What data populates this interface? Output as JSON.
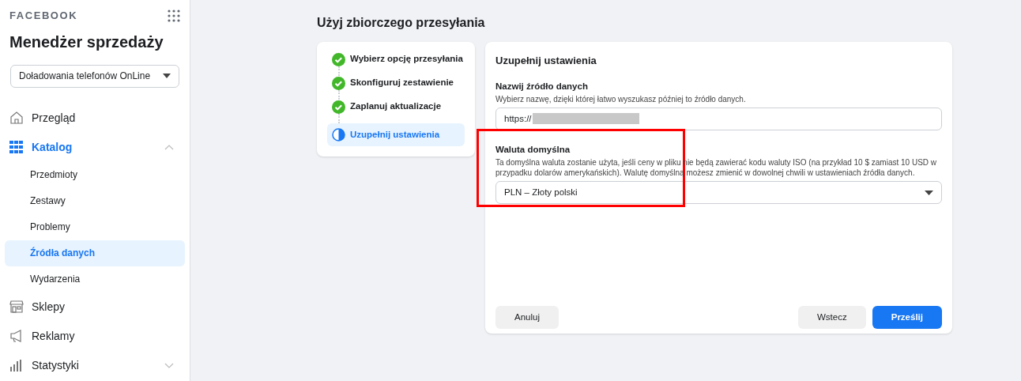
{
  "sidebar": {
    "brand": "FACEBOOK",
    "title": "Menedżer sprzedaży",
    "account_select": {
      "value": "Doładowania telefonów OnLine"
    },
    "items": [
      {
        "label": "Przegląd",
        "selected": false
      },
      {
        "label": "Katalog",
        "selected": true,
        "expanded": true,
        "children": [
          {
            "label": "Przedmioty",
            "selected": false
          },
          {
            "label": "Zestawy",
            "selected": false
          },
          {
            "label": "Problemy",
            "selected": false
          },
          {
            "label": "Źródła danych",
            "selected": true
          },
          {
            "label": "Wydarzenia",
            "selected": false
          }
        ]
      },
      {
        "label": "Sklepy",
        "selected": false
      },
      {
        "label": "Reklamy",
        "selected": false
      },
      {
        "label": "Statystyki",
        "selected": false,
        "expanded": false
      }
    ]
  },
  "page_title": "Użyj zbiorczego przesyłania",
  "steps": [
    {
      "label": "Wybierz opcję przesyłania",
      "completed": true,
      "selected": false
    },
    {
      "label": "Skonfiguruj zestawienie",
      "completed": true,
      "selected": false
    },
    {
      "label": "Zaplanuj aktualizacje",
      "completed": true,
      "selected": false
    },
    {
      "label": "Uzupełnij ustawienia",
      "completed": false,
      "selected": true
    }
  ],
  "form": {
    "title": "Uzupełnij ustawienia",
    "fields": [
      {
        "kind": "text",
        "label": "Nazwij źródło danych",
        "help": "Wybierz nazwę, dzięki której łatwo wyszukasz później to źródło danych.",
        "value": "https://",
        "redacted": true
      },
      {
        "kind": "select",
        "label": "Waluta domyślna",
        "help": "Ta domyślna waluta zostanie użyta, jeśli ceny w pliku nie będą zawierać kodu waluty ISO (na przykład 10 $ zamiast 10 USD w przypadku dolarów amerykańskich). Walutę domyślną możesz zmienić w dowolnej chwili w ustawieniach źródła danych.",
        "value": "PLN – Złoty polski",
        "highlighted": true
      }
    ],
    "buttons": [
      {
        "label": "Anuluj",
        "kind": "secondary"
      },
      {
        "label": "Wstecz",
        "kind": "secondary"
      },
      {
        "label": "Prześlij",
        "kind": "primary"
      }
    ]
  }
}
